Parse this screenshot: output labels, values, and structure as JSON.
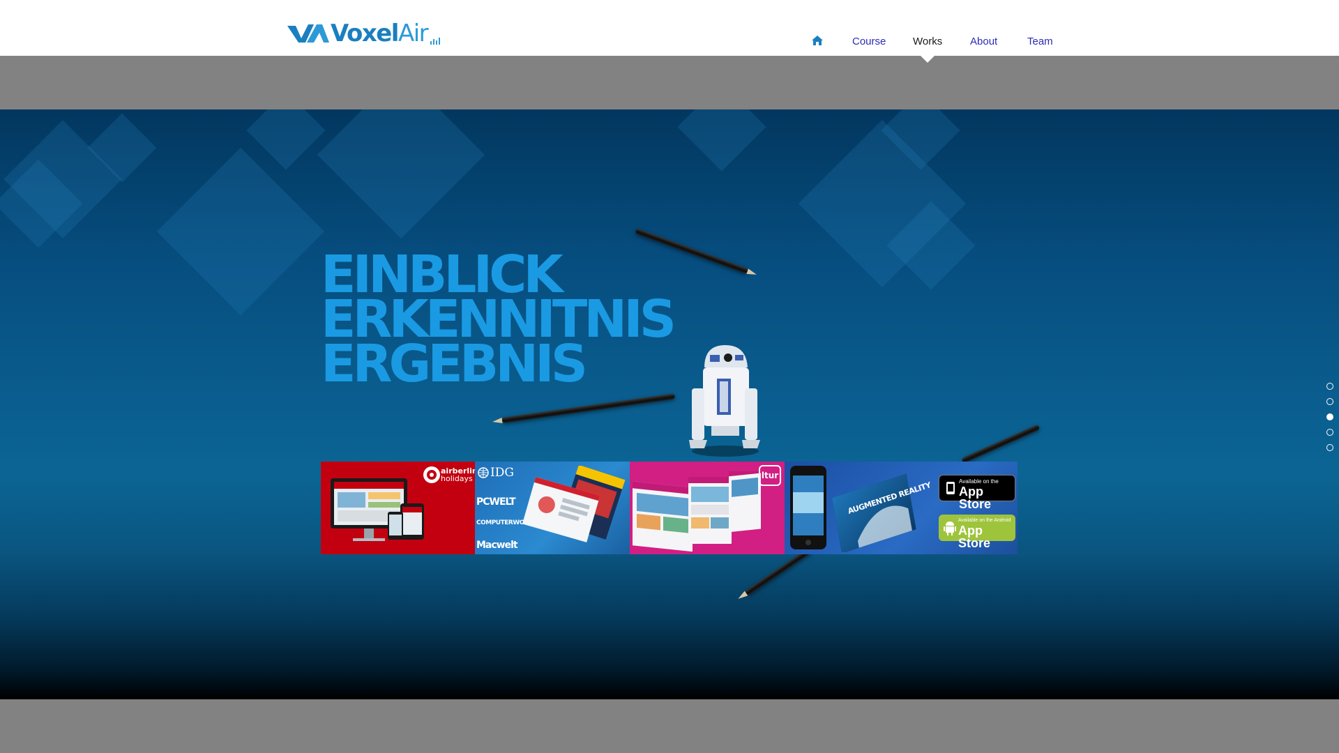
{
  "brand": {
    "logo_bold": "Voxel",
    "logo_light": "Air",
    "accent": "#1a7fc0"
  },
  "nav": {
    "home_icon": "home-icon",
    "items": [
      {
        "label": "Course",
        "active": false
      },
      {
        "label": "Works",
        "active": true
      },
      {
        "label": "About",
        "active": false
      },
      {
        "label": "Team",
        "active": false
      }
    ]
  },
  "hero": {
    "headline": [
      "EINBLICK",
      "ERKENNITNIS",
      "ERGEBNIS"
    ],
    "headline_color": "#1a9ae3"
  },
  "works": [
    {
      "name": "airberlin",
      "brand_line1": "airberlin",
      "brand_line2": "holidays",
      "color": "#c3000f"
    },
    {
      "name": "idg",
      "brand": "IDG",
      "titles": [
        "PCWELT",
        "COMPUTERWOCHE",
        "Macwelt"
      ],
      "color": "#2b8ad0"
    },
    {
      "name": "travel",
      "brand": "ltur",
      "color": "#d11f84"
    },
    {
      "name": "augmented-reality",
      "book_title": "AUGMENTED REALITY",
      "color": "#2a6bc4",
      "badges": [
        {
          "small": "Available on the",
          "big": "App Store",
          "icon": "apple-icon"
        },
        {
          "small": "Available on the Android",
          "big": "App Store",
          "icon": "android-icon"
        }
      ]
    }
  ],
  "pager": {
    "count": 5,
    "active_index": 2
  }
}
